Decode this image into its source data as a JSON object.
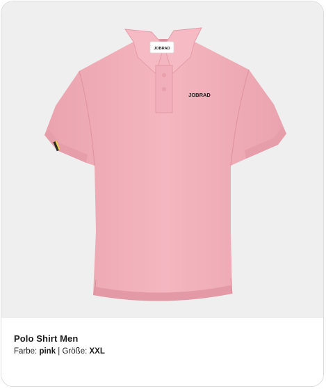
{
  "product": {
    "name": "Polo Shirt Men",
    "color_label": "Farbe:",
    "color_value": "pink",
    "separator": "|",
    "size_label": "Größe:",
    "size_value": "XXL"
  },
  "image": {
    "collar_tag_text": "JOBRAD",
    "chest_logo_text": "JOBRAD",
    "shirt_color": "#f3b4be",
    "background_color": "#efefef"
  }
}
